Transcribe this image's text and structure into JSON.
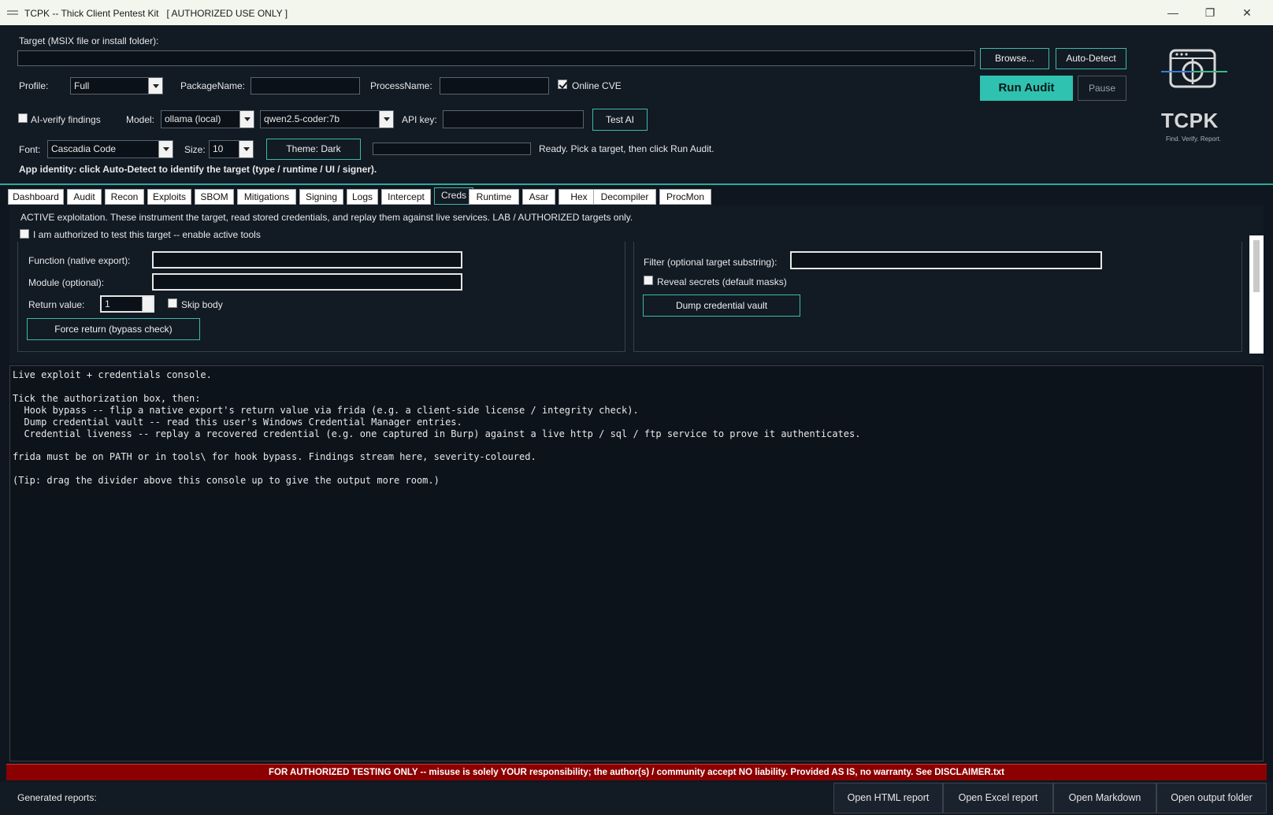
{
  "window": {
    "title": "TCPK -- Thick Client Pentest Kit   [ AUTHORIZED USE ONLY ]",
    "minimize": "—",
    "maximize": "❐",
    "close": "✕"
  },
  "target": {
    "label": "Target (MSIX file or install folder):",
    "value": "",
    "browse": "Browse...",
    "autodetect": "Auto-Detect"
  },
  "profile": {
    "label": "Profile:",
    "value": "Full",
    "package_label": "PackageName:",
    "package_value": "",
    "process_label": "ProcessName:",
    "process_value": "",
    "online_cve_label": "Online CVE",
    "online_cve_checked": true
  },
  "actions": {
    "run_audit": "Run Audit",
    "pause": "Pause"
  },
  "ai": {
    "verify_label": "AI-verify findings",
    "verify_checked": false,
    "model_label": "Model:",
    "provider": "ollama (local)",
    "model": "qwen2.5-coder:7b",
    "api_key_label": "API key:",
    "api_key_value": "",
    "test_ai": "Test AI"
  },
  "appearance": {
    "font_label": "Font:",
    "font_value": "Cascadia Code",
    "size_label": "Size:",
    "size_value": "10",
    "theme_button": "Theme: Dark"
  },
  "status": {
    "progress": 0,
    "text": "Ready. Pick a target, then click Run Audit.",
    "identity": "App identity: click Auto-Detect to identify the target (type / runtime / UI / signer)."
  },
  "logo": {
    "name": "TCPK",
    "tagline": "Find. Verify. Report."
  },
  "tabs": [
    {
      "label": "Dashboard"
    },
    {
      "label": "Audit"
    },
    {
      "label": "Recon"
    },
    {
      "label": "Exploits"
    },
    {
      "label": "SBOM"
    },
    {
      "label": "Mitigations"
    },
    {
      "label": "Signing"
    },
    {
      "label": "Logs"
    },
    {
      "label": "Intercept"
    },
    {
      "label": "Creds"
    },
    {
      "label": "Runtime"
    },
    {
      "label": "Asar"
    },
    {
      "label": "Hex"
    },
    {
      "label": "Decompiler"
    },
    {
      "label": "ProcMon"
    }
  ],
  "active_tab": "Creds",
  "creds": {
    "banner": "ACTIVE exploitation. These instrument the target, read stored credentials, and replay them against live services. LAB / AUTHORIZED targets only.",
    "authorize_label": "I am authorized to test this target -- enable active tools",
    "authorize_checked": false,
    "hook": {
      "function_label": "Function (native export):",
      "function_value": "",
      "module_label": "Module (optional):",
      "module_value": "",
      "return_label": "Return value:",
      "return_value": "1",
      "skip_body_label": "Skip body",
      "skip_body_checked": false,
      "force_button": "Force return (bypass check)"
    },
    "vault": {
      "filter_label": "Filter (optional target substring):",
      "filter_value": "",
      "reveal_label": "Reveal secrets (default masks)",
      "reveal_checked": false,
      "dump_button": "Dump credential vault"
    }
  },
  "console": {
    "text": "Live exploit + credentials console.\n\nTick the authorization box, then:\n  Hook bypass -- flip a native export's return value via frida (e.g. a client-side license / integrity check).\n  Dump credential vault -- read this user's Windows Credential Manager entries.\n  Credential liveness -- replay a recovered credential (e.g. one captured in Burp) against a live http / sql / ftp service to prove it authenticates.\n\nfrida must be on PATH or in tools\\ for hook bypass. Findings stream here, severity-coloured.\n\n(Tip: drag the divider above this console up to give the output more room.)"
  },
  "disclaimer": "FOR AUTHORIZED TESTING ONLY  --  misuse is solely YOUR responsibility; the author(s) / community accept NO liability.  Provided AS IS, no warranty.  See DISCLAIMER.txt",
  "footer": {
    "label": "Generated reports:",
    "html": "Open HTML report",
    "excel": "Open Excel report",
    "markdown": "Open Markdown",
    "folder": "Open output folder"
  },
  "colors": {
    "accent": "#2fc2b0",
    "background": "#121a24",
    "console_bg": "#0c131b",
    "disclaimer_bg": "#8b0000"
  }
}
